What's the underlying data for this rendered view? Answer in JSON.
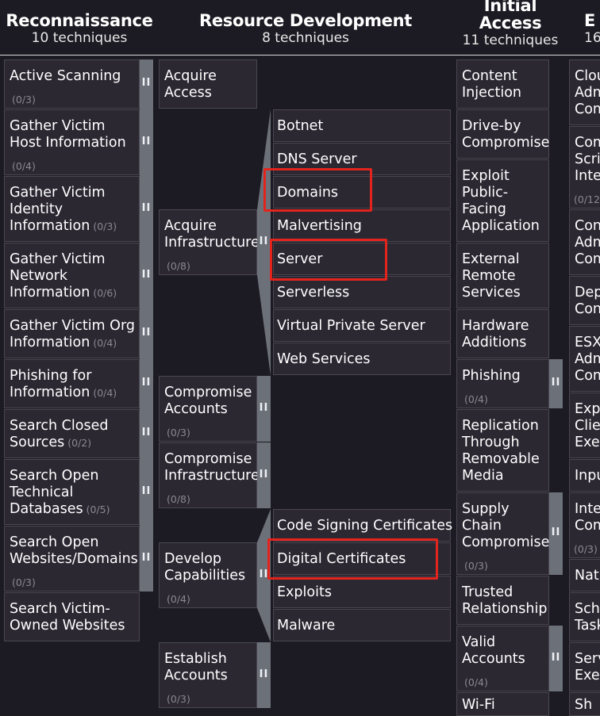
{
  "tactics": [
    {
      "name": "Reconnaissance",
      "count": "10  techniques"
    },
    {
      "name": "Resource Development",
      "count": "8  techniques"
    },
    {
      "name_line1": "Initial",
      "name_line2": "Access",
      "count": "11  techniques"
    },
    {
      "name": "E",
      "count": "16"
    }
  ],
  "recon": [
    {
      "l1": "Active Scanning",
      "ct": "(0/3)"
    },
    {
      "l1": "Gather Victim",
      "l2": "Host Information",
      "ct": "(0/4)"
    },
    {
      "l1": "Gather Victim",
      "l2": "Identity",
      "l3": "Information",
      "ct": "(0/3)"
    },
    {
      "l1": "Gather Victim",
      "l2": "Network",
      "l3": "Information",
      "ct": "(0/6)"
    },
    {
      "l1": "Gather Victim Org",
      "l2": "Information",
      "ct": "(0/4)"
    },
    {
      "l1": "Phishing for",
      "l2": "Information",
      "ct": "(0/4)"
    },
    {
      "l1": "Search Closed",
      "l2": "Sources",
      "ct": "(0/2)"
    },
    {
      "l1": "Search Open",
      "l2": "Technical",
      "l3": "Databases",
      "ct": "(0/5)"
    },
    {
      "l1": "Search Open",
      "l2": "Websites/Domains",
      "ct": "(0/3)"
    },
    {
      "l1": "Search Victim-",
      "l2": "Owned Websites"
    }
  ],
  "resdev": [
    {
      "l1": "Acquire",
      "l2": "Access"
    },
    {
      "l1": "Acquire",
      "l2": "Infrastructure",
      "ct": "(0/8)"
    },
    {
      "l1": "Compromise",
      "l2": "Accounts",
      "ct": "(0/3)"
    },
    {
      "l1": "Compromise",
      "l2": "Infrastructure",
      "ct": "(0/8)"
    },
    {
      "l1": "Develop",
      "l2": "Capabilities",
      "ct": "(0/4)"
    },
    {
      "l1": "Establish",
      "l2": "Accounts",
      "ct": "(0/3)"
    }
  ],
  "infra_subs": [
    "Botnet",
    "DNS Server",
    "Domains",
    "Malvertising",
    "Server",
    "Serverless",
    "Virtual Private Server",
    "Web Services"
  ],
  "cap_subs": [
    "Code Signing Certificates",
    "Digital Certificates",
    "Exploits",
    "Malware"
  ],
  "initial": [
    {
      "l1": "Content",
      "l2": "Injection"
    },
    {
      "l1": "Drive-by",
      "l2": "Compromise"
    },
    {
      "l1": "Exploit",
      "l2": "Public-",
      "l3": "Facing",
      "l4": "Application"
    },
    {
      "l1": "External",
      "l2": "Remote",
      "l3": "Services"
    },
    {
      "l1": "Hardware",
      "l2": "Additions"
    },
    {
      "l1": "Phishing",
      "ct": "(0/4)"
    },
    {
      "l1": "Replication",
      "l2": "Through",
      "l3": "Removable",
      "l4": "Media"
    },
    {
      "l1": "Supply",
      "l2": "Chain",
      "l3": "Compromise",
      "ct": "(0/3)"
    },
    {
      "l1": "Trusted",
      "l2": "Relationship"
    },
    {
      "l1": "Valid",
      "l2": "Accounts",
      "ct": "(0/4)"
    },
    {
      "l1": "Wi-Fi"
    }
  ],
  "execution": [
    {
      "l1": "Clou",
      "l2": "Adm",
      "l3": "Com"
    },
    {
      "l1": "Com",
      "l2": "Scrip",
      "l3": "Inte",
      "ct": "(0/12"
    },
    {
      "l1": "Cont",
      "l2": "Adm",
      "l3": "Com"
    },
    {
      "l1": "Dep",
      "l2": "Con"
    },
    {
      "l1": "ESXi",
      "l2": "Adm",
      "l3": "Com"
    },
    {
      "l1": "Expl",
      "l2": "Clier",
      "l3": "Exec"
    },
    {
      "l1": "Inpu"
    },
    {
      "l1": "Inte",
      "l2": "Com",
      "ct": "(0/3)"
    },
    {
      "l1": "Nati"
    },
    {
      "l1": "Sche",
      "l2": "Task"
    },
    {
      "l1": "Serv",
      "l2": "Exec"
    },
    {
      "l1": "Sh"
    }
  ],
  "handle_glyph": "II",
  "colors": {
    "background": "#1c1a22",
    "cell": "#2b2832",
    "handle": "#6c7079",
    "highlight": "#e3241d"
  }
}
